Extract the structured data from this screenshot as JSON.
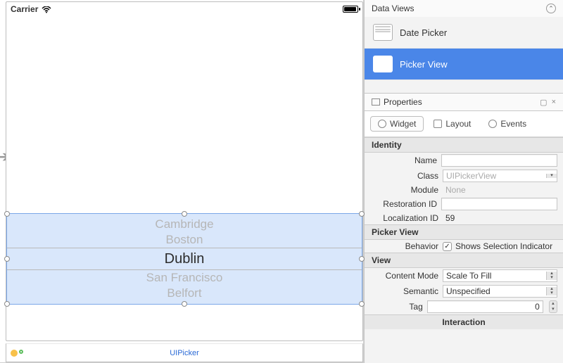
{
  "status": {
    "carrier": "Carrier"
  },
  "picker": {
    "items": [
      "Cambridge",
      "Boston",
      "Dublin",
      "San Francisco",
      "Belfort"
    ],
    "selected_index": 2,
    "widget_label": "UIPicker"
  },
  "inspector": {
    "dataviews": {
      "title": "Data Views",
      "items": [
        "Date Picker",
        "Picker View"
      ],
      "selected_index": 1
    },
    "properties_title": "Properties",
    "tabs": {
      "widget": "Widget",
      "layout": "Layout",
      "events": "Events"
    },
    "identity": {
      "title": "Identity",
      "name_label": "Name",
      "name_value": "",
      "class_label": "Class",
      "class_value": "UIPickerView",
      "module_label": "Module",
      "module_value": "None",
      "restoration_label": "Restoration ID",
      "restoration_value": "",
      "localization_label": "Localization ID",
      "localization_value": "59"
    },
    "pickerview": {
      "title": "Picker View",
      "behavior_label": "Behavior",
      "shows_selection_label": "Shows Selection Indicator",
      "shows_selection": true
    },
    "view": {
      "title": "View",
      "content_mode_label": "Content Mode",
      "content_mode": "Scale To Fill",
      "semantic_label": "Semantic",
      "semantic": "Unspecified",
      "tag_label": "Tag",
      "tag": "0"
    },
    "interaction_title": "Interaction"
  }
}
